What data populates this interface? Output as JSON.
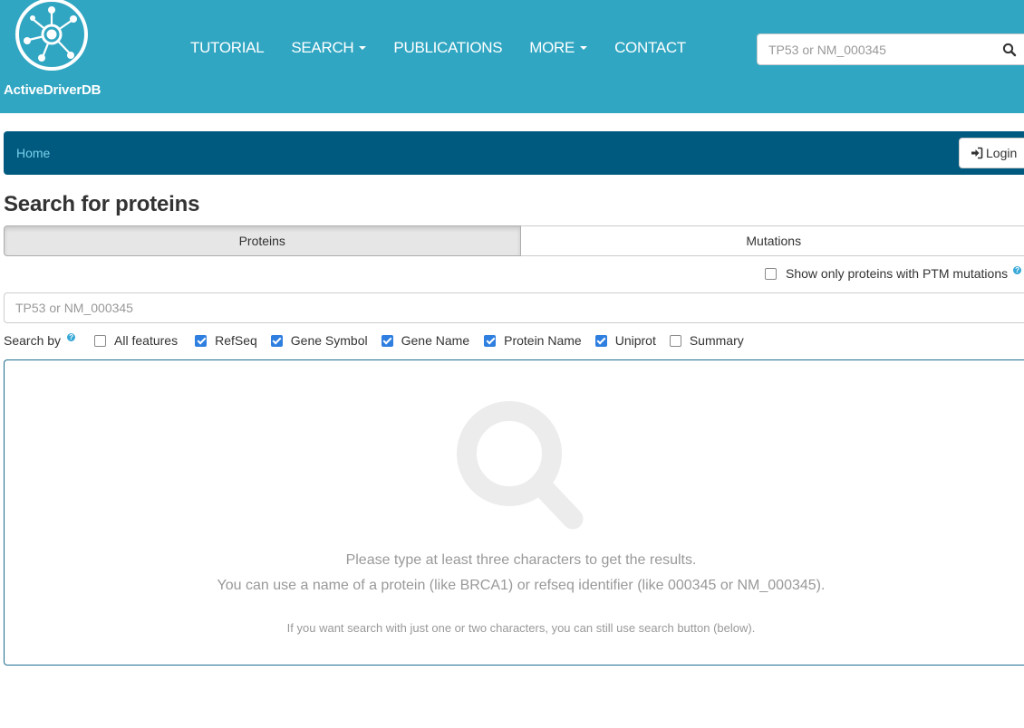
{
  "header": {
    "brand": "ActiveDriverDB",
    "nav": {
      "tutorial": "TUTORIAL",
      "search": "SEARCH",
      "publications": "PUBLICATIONS",
      "more": "MORE",
      "contact": "CONTACT"
    },
    "search": {
      "placeholder": "TP53 or NM_000345",
      "icon": "search-icon"
    },
    "color": "#30a6c2"
  },
  "breadcrumb": {
    "home": "Home",
    "login_label": "Login",
    "color": "#005a7f"
  },
  "main": {
    "title": "Search for proteins",
    "tabs": [
      {
        "label": "Proteins",
        "active": true
      },
      {
        "label": "Mutations",
        "active": false
      }
    ],
    "ptm_filter": {
      "label": "Show only proteins with PTM mutations",
      "checked": false
    },
    "search_placeholder": "TP53 or NM_000345",
    "search_by": {
      "label": "Search by",
      "options": [
        {
          "label": "All features",
          "checked": false
        },
        {
          "label": "RefSeq",
          "checked": true
        },
        {
          "label": "Gene Symbol",
          "checked": true
        },
        {
          "label": "Gene Name",
          "checked": true
        },
        {
          "label": "Protein Name",
          "checked": true
        },
        {
          "label": "Uniprot",
          "checked": true
        },
        {
          "label": "Summary",
          "checked": false
        }
      ]
    },
    "results": {
      "icon": "magnifier-icon",
      "line1": "Please type at least three characters to get the results.",
      "line2": "You can use a name of a protein (like BRCA1) or refseq identifier (like 000345 or NM_000345).",
      "line3": "If you want search with just one or two characters, you can still use search button (below)."
    }
  }
}
